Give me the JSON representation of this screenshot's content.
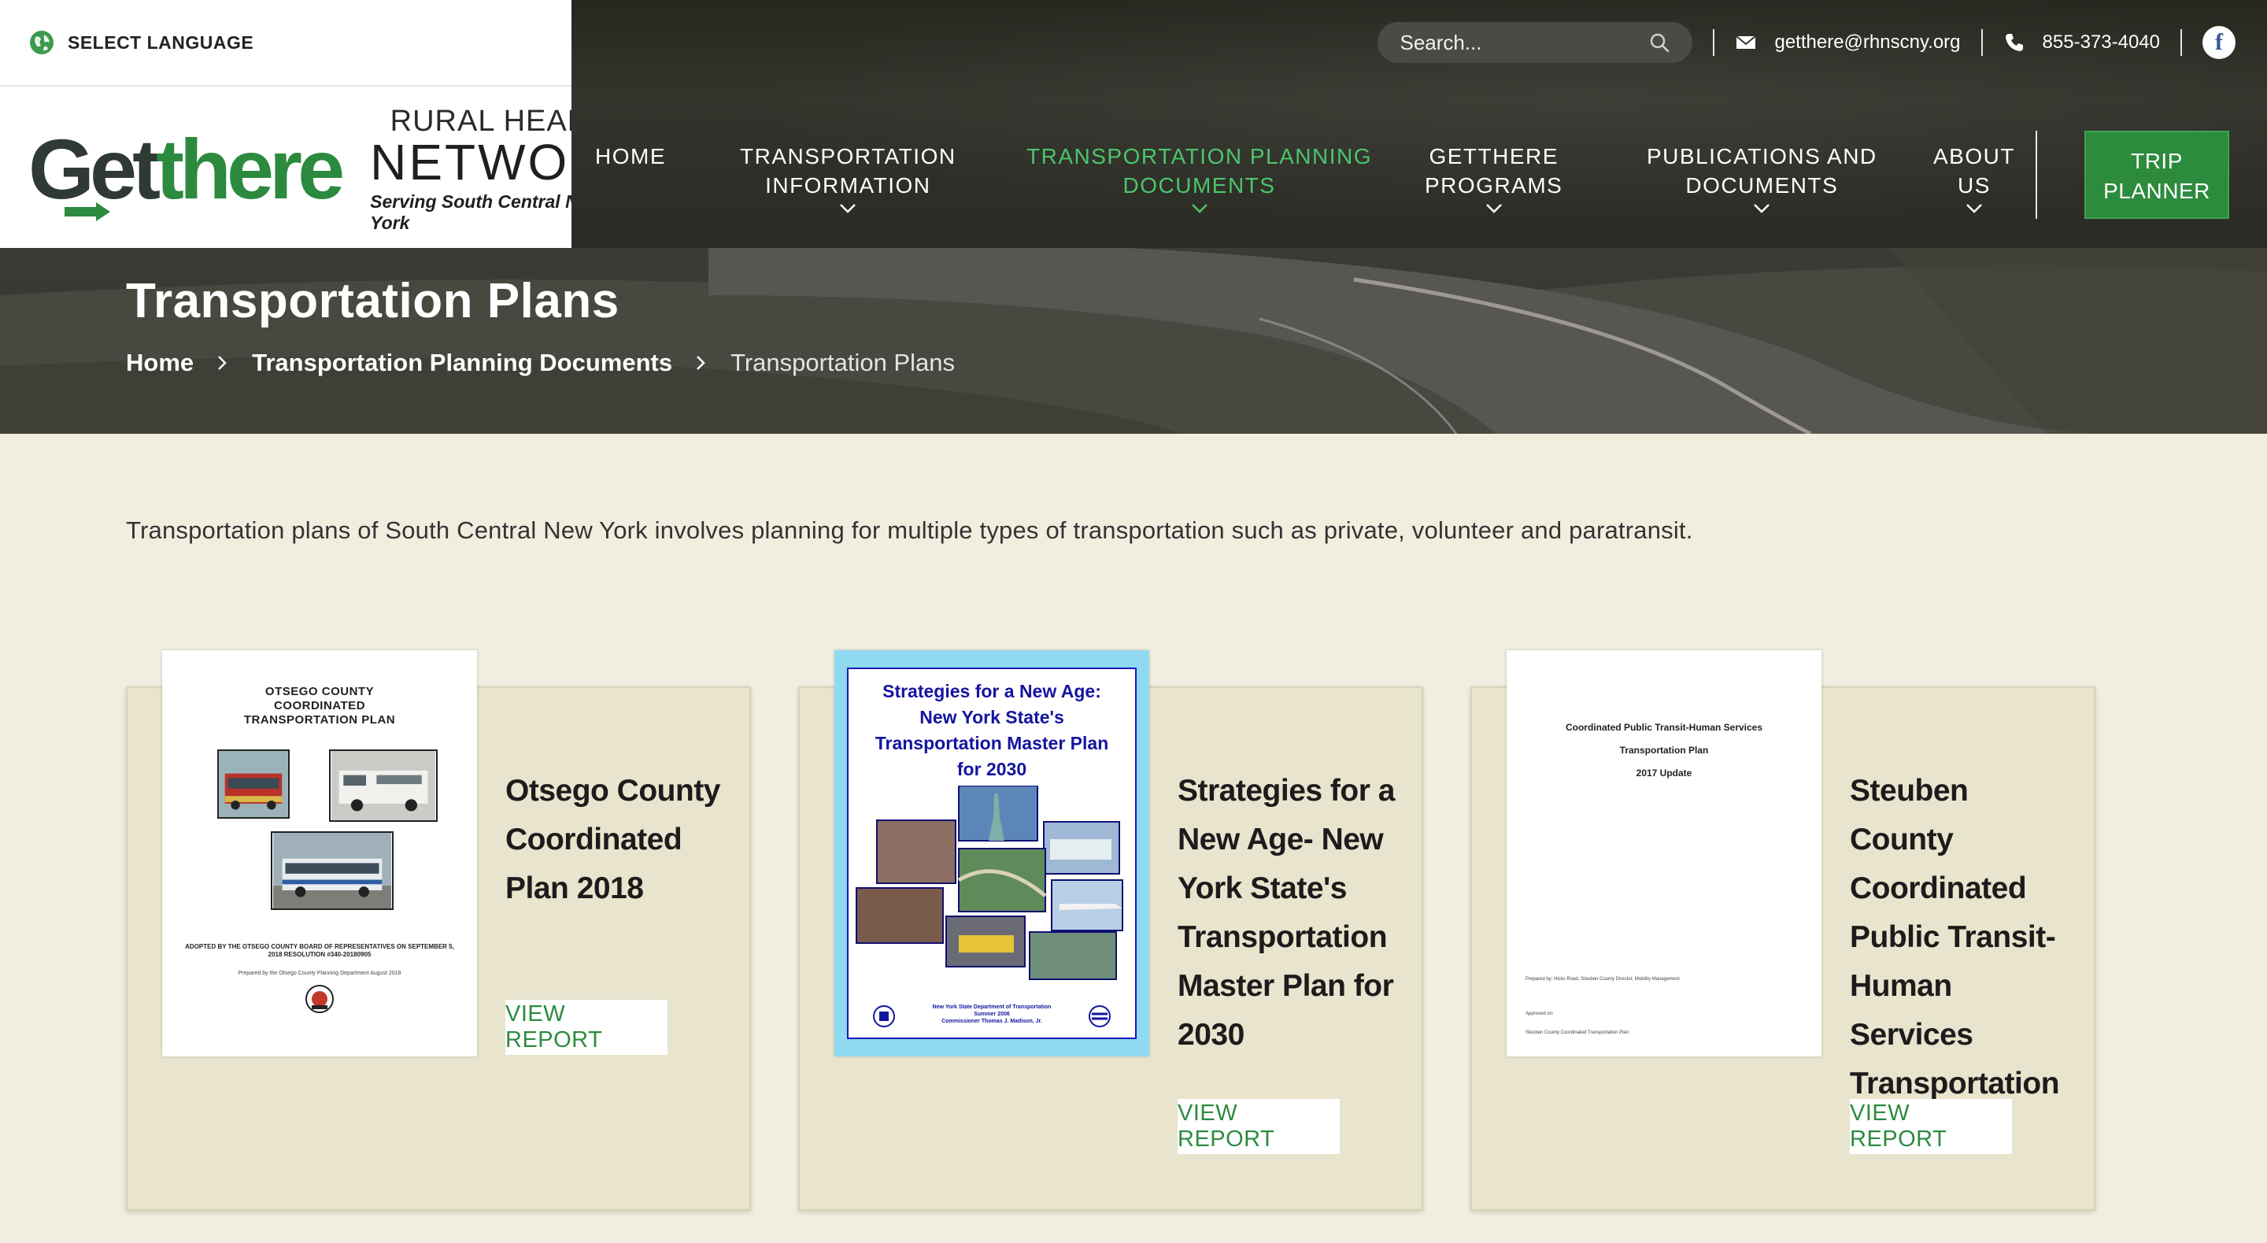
{
  "language": {
    "label": "SELECT LANGUAGE"
  },
  "logo": {
    "brand_part1": "Get",
    "brand_part2": "there",
    "rhn_line1": "RURAL HEALTH",
    "rhn_line2": "NETWORK",
    "rhn_tagline": "Serving South Central New York"
  },
  "utility": {
    "search_placeholder": "Search...",
    "email": "getthere@rhnscny.org",
    "phone": "855-373-4040",
    "facebook_glyph": "f"
  },
  "nav": {
    "items": [
      {
        "line1": "HOME",
        "line2": "",
        "active": false,
        "has_dropdown": false
      },
      {
        "line1": "TRANSPORTATION",
        "line2": "INFORMATION",
        "active": false,
        "has_dropdown": true
      },
      {
        "line1": "TRANSPORTATION PLANNING",
        "line2": "DOCUMENTS",
        "active": true,
        "has_dropdown": true
      },
      {
        "line1": "GETTHERE",
        "line2": "PROGRAMS",
        "active": false,
        "has_dropdown": true
      },
      {
        "line1": "PUBLICATIONS AND",
        "line2": "DOCUMENTS",
        "active": false,
        "has_dropdown": true
      },
      {
        "line1": "ABOUT",
        "line2": "US",
        "active": false,
        "has_dropdown": true
      }
    ],
    "trip_planner": {
      "line1": "TRIP",
      "line2": "PLANNER"
    }
  },
  "hero": {
    "title": "Transportation Plans",
    "breadcrumb": [
      "Home",
      "Transportation Planning Documents",
      "Transportation Plans"
    ]
  },
  "intro": "Transportation plans of South Central New York involves planning for multiple types of transportation such as private, volunteer and paratransit.",
  "cards": [
    {
      "title": "Otsego County Coordinated Plan 2018",
      "button": "VIEW REPORT",
      "thumb": {
        "heading": [
          "OTSEGO COUNTY",
          "COORDINATED",
          "TRANSPORTATION PLAN"
        ],
        "caption1": "ADOPTED BY THE OTSEGO COUNTY BOARD OF REPRESENTATIVES ON SEPTEMBER 5, 2018 RESOLUTION #340-20180905",
        "caption2": "Prepared by the Otsego County Planning Department August 2018"
      }
    },
    {
      "title": "Strategies for a New Age- New York State's Transportation Master Plan for 2030",
      "button": "VIEW REPORT",
      "thumb": {
        "heading": [
          "Strategies for a New Age:",
          "New York State's",
          "Transportation Master Plan",
          "for 2030"
        ],
        "footer": [
          "New York State Department of Transportation",
          "Summer 2006",
          "Commissioner Thomas J. Madison, Jr."
        ]
      }
    },
    {
      "title": "Steuben County Coordinated Public Transit-Human Services Transportation Plan",
      "button": "VIEW REPORT",
      "thumb": {
        "heading": [
          "Coordinated Public Transit-Human Services",
          "Transportation Plan",
          "2017 Update"
        ],
        "prepared_by": "Prepared by:   Hicks Road, Steuben County Director, Mobility Management",
        "approved_on": "Approved on:",
        "footer": "Steuben County Coordinated Transportation Plan"
      }
    }
  ],
  "colors": {
    "accent_green": "#2d8b3e",
    "active_nav_green": "#4cc56a",
    "page_bg": "#f1eedf",
    "card_bg": "#e8e4cd"
  }
}
